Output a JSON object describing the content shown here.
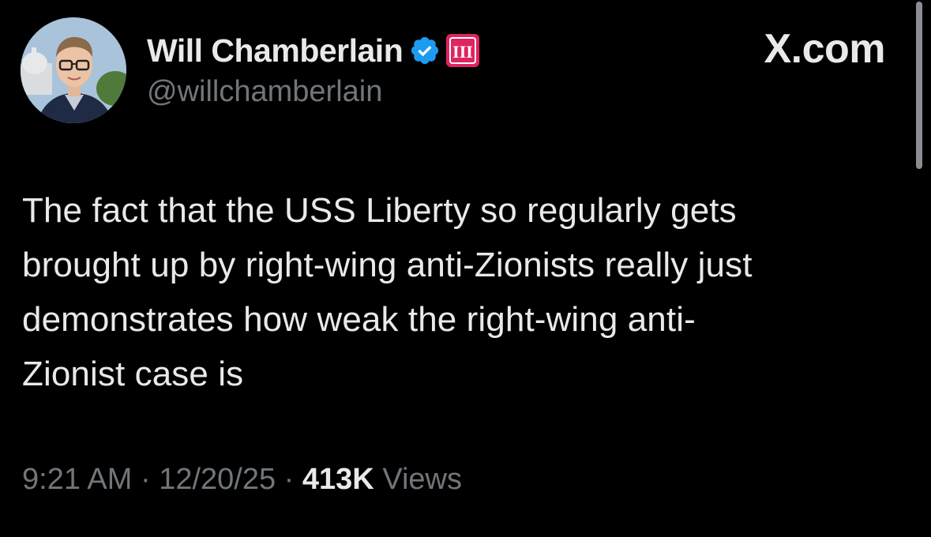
{
  "author": {
    "display_name": "Will Chamberlain",
    "handle": "@willchamberlain",
    "verified_icon": "verified-badge-icon",
    "affiliation_icon": "roman-numeral-three-icon",
    "affiliation_glyph": "III"
  },
  "brand": {
    "label": "X.com"
  },
  "tweet": {
    "text": "The fact that the USS Liberty so regularly gets\nbrought up by right-wing anti-Zionists really just\ndemonstrates how weak the right-wing anti-\nZionist case is"
  },
  "meta": {
    "time": "9:21 AM",
    "separator1": " · ",
    "date": "12/20/25",
    "separator2": " · ",
    "views_count": "413K",
    "views_label": "Views"
  },
  "colors": {
    "background": "#000000",
    "text_primary": "#e7e9ea",
    "text_secondary": "#71767b",
    "verified_blue": "#1d9bf0",
    "affiliation_red": "#e0245e"
  }
}
